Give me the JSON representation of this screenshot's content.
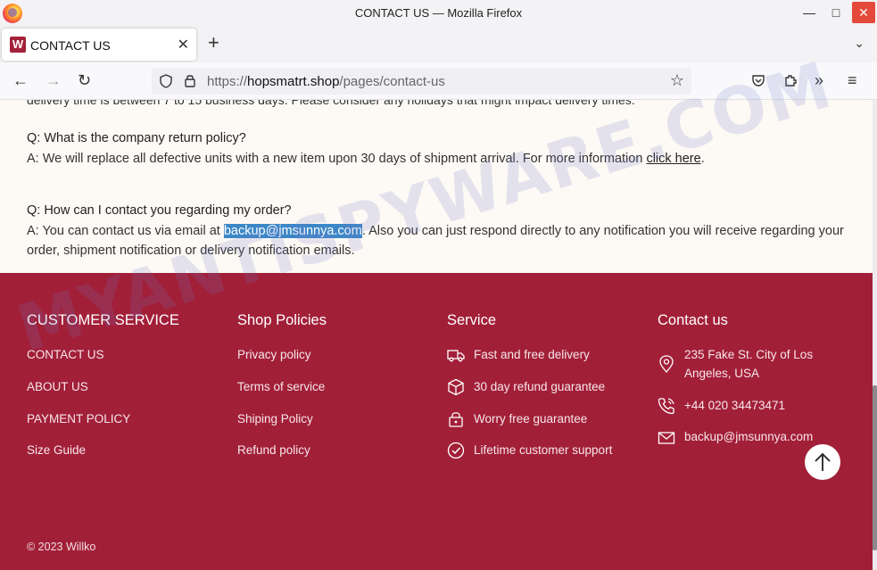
{
  "window": {
    "title": "CONTACT US — Mozilla Firefox"
  },
  "tab": {
    "favicon_letter": "W",
    "label": "CONTACT US"
  },
  "urlbar": {
    "scheme": "https://",
    "domain": "hopsmatrt.shop",
    "path": "/pages/contact-us"
  },
  "faq": {
    "cut_text": "delivery time is between 7 to 15 business days.  Please consider any holidays that might impact delivery times.",
    "q1": "Q: What is the company return policy?",
    "a1_text": "A: We will replace all defective units with a new item upon 30 days of shipment arrival.  For more information ",
    "a1_link": "click here",
    "a1_end": ".",
    "q2": "Q: How can I contact you regarding my order?",
    "a2_pre": "A: You can contact us via email at ",
    "a2_email": "backup@jmsunnya.com",
    "a2_post": ". Also you can just respond directly to any notification you will receive regarding your order, shipment notification or delivery notification emails."
  },
  "footer": {
    "customer_service": {
      "title": "CUSTOMER SERVICE",
      "links": [
        "CONTACT US",
        "ABOUT US",
        "PAYMENT POLICY",
        "Size Guide"
      ]
    },
    "shop_policies": {
      "title": "Shop Policies",
      "links": [
        "Privacy policy",
        "Terms of service",
        "Shiping Policy",
        "Refund policy"
      ]
    },
    "service": {
      "title": "Service",
      "items": [
        {
          "icon": "truck-icon",
          "label": "Fast and free delivery"
        },
        {
          "icon": "box-icon",
          "label": "30 day refund guarantee"
        },
        {
          "icon": "lock-icon",
          "label": "Worry free guarantee"
        },
        {
          "icon": "check-circle-icon",
          "label": "Lifetime customer support"
        }
      ]
    },
    "contact": {
      "title": "Contact us",
      "address_line1": "235 Fake St. City of Los",
      "address_line2": "Angeles, USA",
      "phone": "+44 020 34473471",
      "email": "backup@jmsunnya.com"
    },
    "copyright": "© 2023 Willko"
  },
  "watermark": "MYANTISPYWARE.COM",
  "colors": {
    "footer_bg": "#a21f38",
    "page_bg": "#fdf9f5",
    "highlight": "#3c87c7"
  }
}
